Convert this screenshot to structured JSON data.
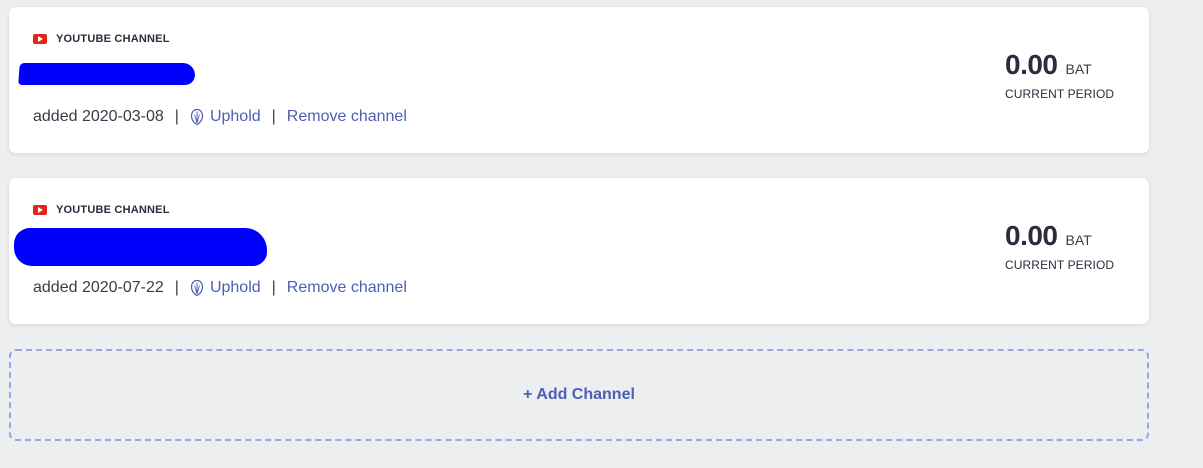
{
  "colors": {
    "background": "#eceef0",
    "card": "#ffffff",
    "link": "#4c5fb2",
    "youtube_red": "#e1251b",
    "redaction": "#0000ff",
    "dashed_border": "#9aa5e6"
  },
  "channels": [
    {
      "type_label": "YOUTUBE CHANNEL",
      "icon": "youtube-icon",
      "added_text": "added 2020-03-08",
      "separator": "|",
      "uphold_label": "Uphold",
      "uphold_icon": "uphold-icon",
      "remove_label": "Remove channel",
      "amount": "0.00",
      "currency": "BAT",
      "period_label": "CURRENT PERIOD"
    },
    {
      "type_label": "YOUTUBE CHANNEL",
      "icon": "youtube-icon",
      "added_text": "added 2020-07-22",
      "separator": "|",
      "uphold_label": "Uphold",
      "uphold_icon": "uphold-icon",
      "remove_label": "Remove channel",
      "amount": "0.00",
      "currency": "BAT",
      "period_label": "CURRENT PERIOD"
    }
  ],
  "add_channel": {
    "label": "+ Add Channel"
  }
}
